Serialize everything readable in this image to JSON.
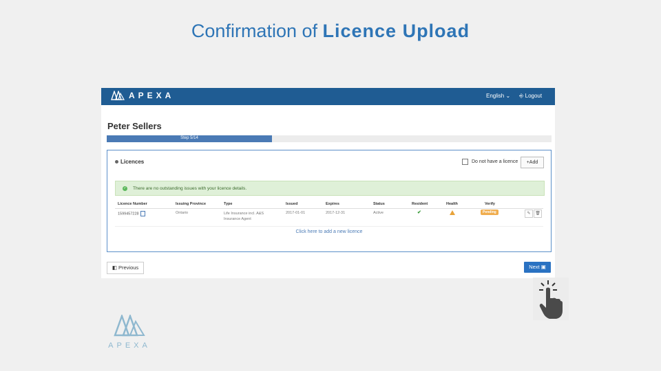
{
  "slide": {
    "title_prefix": "Confirmation of ",
    "title_bold": "Licence Upload"
  },
  "app": {
    "brand": "APEXA",
    "language": "English ⌄",
    "logout": "⎆ Logout",
    "person_name": "Peter Sellers",
    "progress": {
      "label": "Step 5/14",
      "fraction": 0.3714
    },
    "licences": {
      "title": "Licences",
      "no_licence_label": "Do not have a licence",
      "add_button": "+Add",
      "alert": "There are no outstanding issues with your licence details.",
      "columns": [
        "Licence Number",
        "Issuing Province",
        "Type",
        "Issued",
        "Expires",
        "Status",
        "Resident",
        "Health",
        "Verify"
      ],
      "rows": [
        {
          "licence_number": "1599457228",
          "issuing_province": "Ontario",
          "type": "Life Insurance incl. A&S Insurance Agent",
          "issued": "2017-01-01",
          "expires": "2017-12-31",
          "status": "Active",
          "resident": "✔",
          "verify": "Pending"
        }
      ],
      "add_link": "Click here to add a new licence"
    },
    "previous_button": "Previous",
    "next_button": "Next"
  },
  "footer_logo": {
    "word": "APEXA"
  },
  "colors": {
    "header": "#1f5c93",
    "accent": "#2e75b6",
    "alert_bg": "#dff0d8",
    "pending": "#f0ad4e"
  }
}
